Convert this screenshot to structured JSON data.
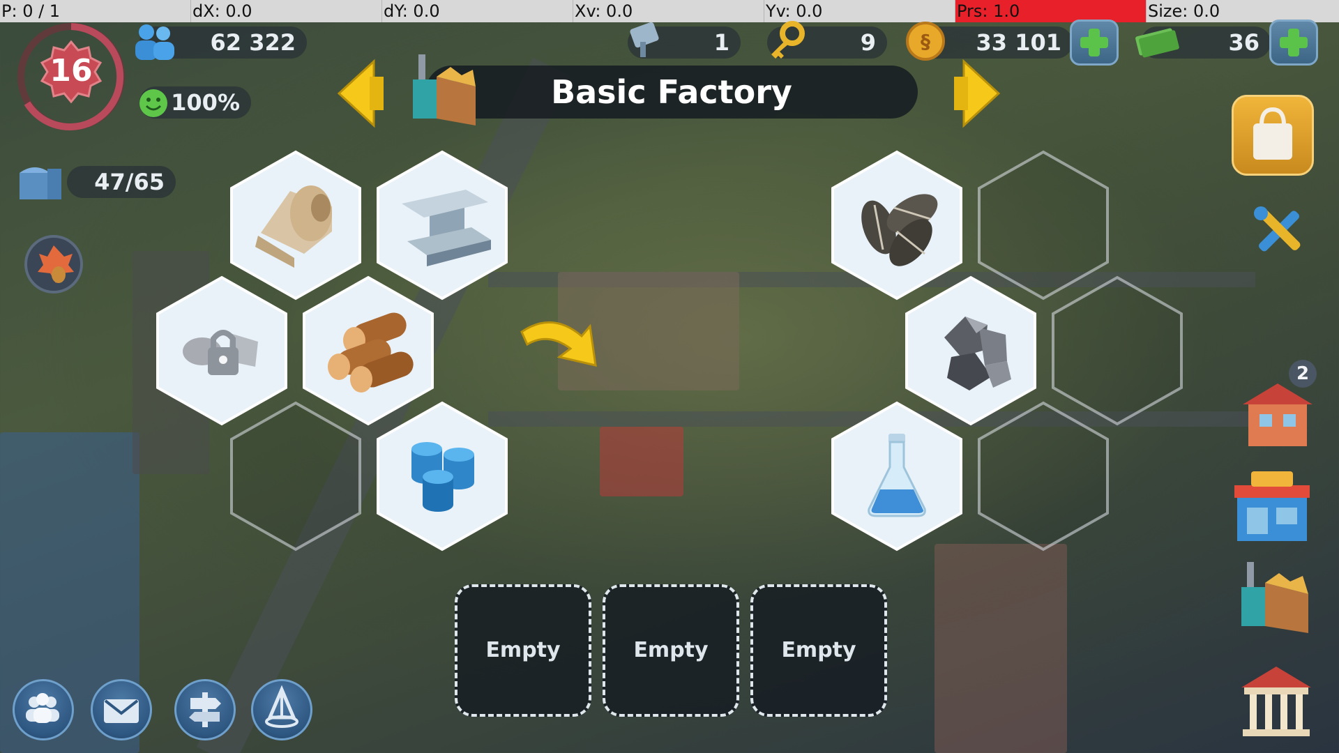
{
  "debug": {
    "cells": [
      "P: 0 / 1",
      "dX: 0.0",
      "dY: 0.0",
      "Xv: 0.0",
      "Yv: 0.0",
      "Prs: 1.0",
      "Size: 0.0"
    ]
  },
  "player": {
    "level": "16",
    "population": "62 322",
    "happiness": "100%",
    "storage": "47/65"
  },
  "resources": {
    "war_tokens": "1",
    "keys": "9",
    "simoleons": "33 101",
    "simcash": "36"
  },
  "header": {
    "title": "Basic Factory"
  },
  "production_slots": [
    "Empty",
    "Empty",
    "Empty"
  ],
  "left_hex_items": [
    {
      "name": "textiles",
      "icon": "cloth-roll-icon",
      "locked": false
    },
    {
      "name": "metal",
      "icon": "metal-beam-icon",
      "locked": false
    },
    {
      "name": "locked-item",
      "icon": "lock-icon",
      "locked": true
    },
    {
      "name": "wood",
      "icon": "wood-logs-icon",
      "locked": false
    },
    {
      "name": "empty",
      "icon": "",
      "locked": false
    },
    {
      "name": "plastic",
      "icon": "plastic-cylinders-icon",
      "locked": false
    }
  ],
  "right_hex_items": [
    {
      "name": "seeds",
      "icon": "seeds-icon"
    },
    {
      "name": "minerals",
      "icon": "minerals-icon"
    },
    {
      "name": "chemicals",
      "icon": "chemical-flask-icon"
    }
  ],
  "notification_count": "2",
  "colors": {
    "debug_alert": "#e8202a",
    "title_bar": "#161c22",
    "hex_fill": "#e9f2f8",
    "arrow_yellow": "#f6c81a",
    "plus_green": "#5bc24a",
    "level_ring": "#b84a5c",
    "level_badge": "#c84a55"
  }
}
